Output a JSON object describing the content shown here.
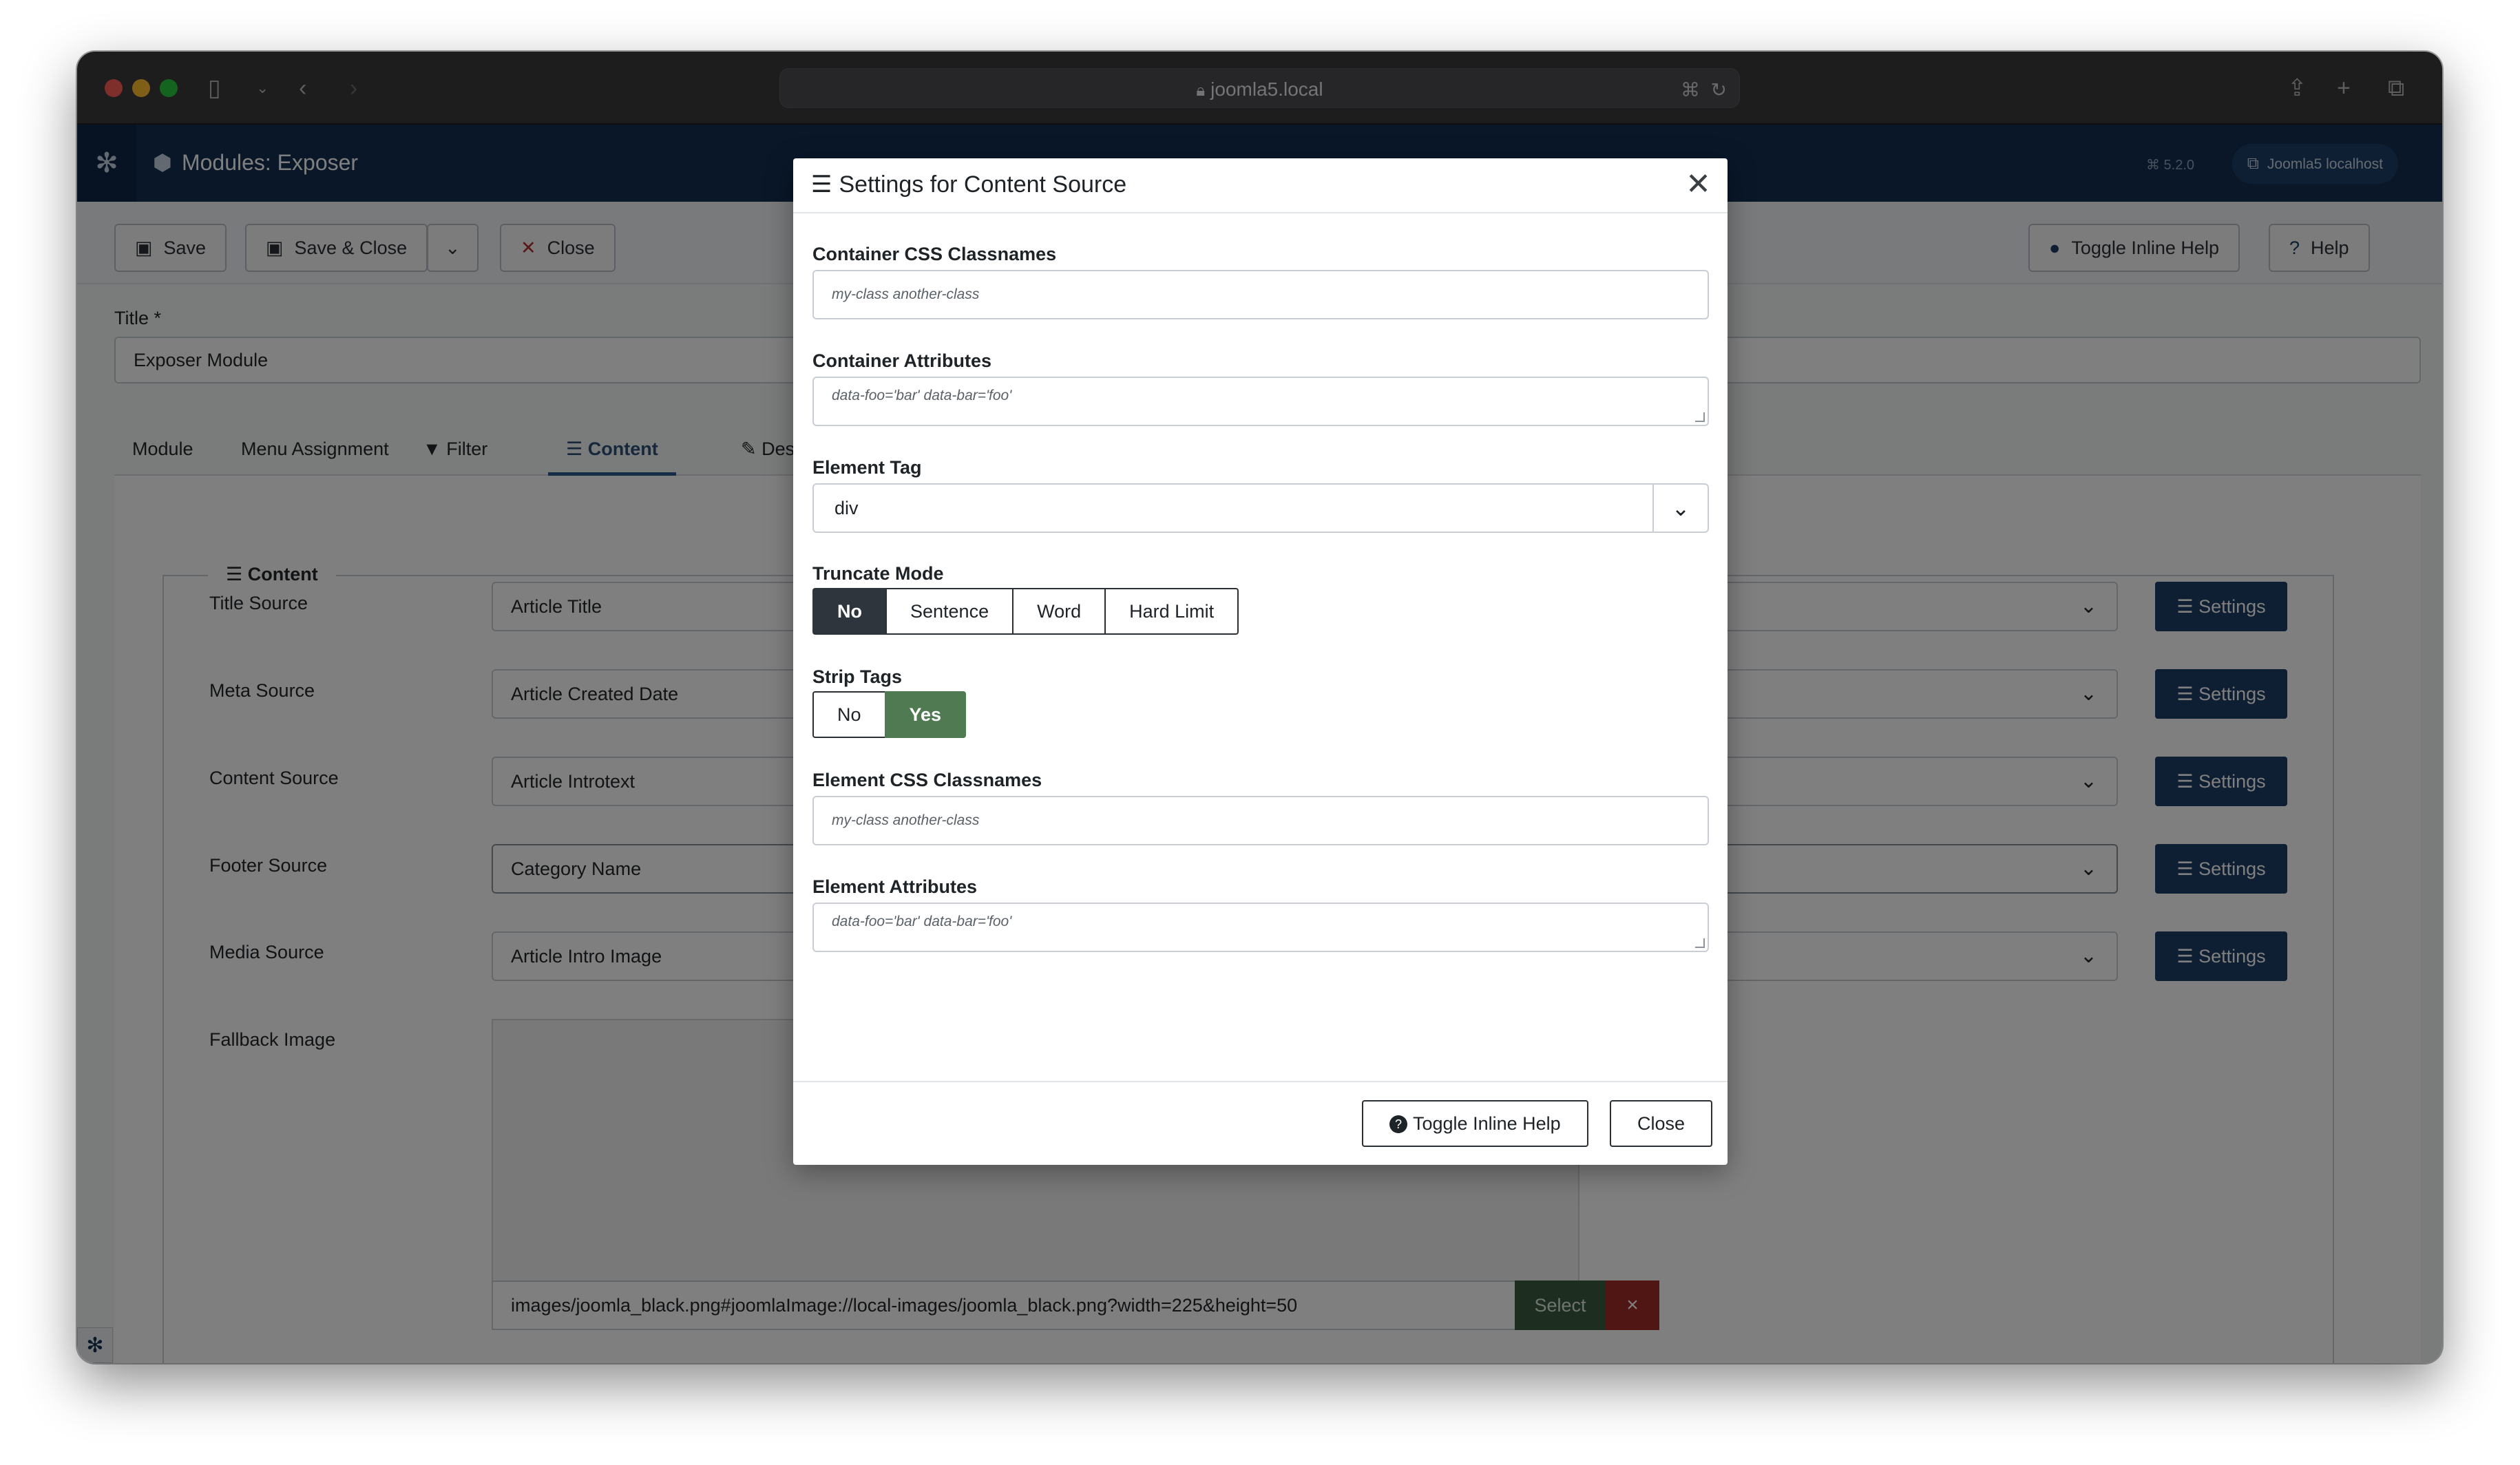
{
  "browser": {
    "url": "joomla5.local"
  },
  "header": {
    "title": "Modules: Exposer",
    "version": "5.2.0",
    "site_link": "Joomla5 localhost"
  },
  "toolbar": {
    "save": "Save",
    "save_close": "Save & Close",
    "close": "Close",
    "toggle_inline_help": "Toggle Inline Help",
    "help": "Help"
  },
  "form": {
    "title_label": "Title *",
    "title_value": "Exposer Module"
  },
  "tabs": [
    {
      "label": "Module"
    },
    {
      "label": "Menu Assignment"
    },
    {
      "label": "Filter"
    },
    {
      "label": "Content"
    },
    {
      "label": "Designer"
    }
  ],
  "content": {
    "legend": "Content",
    "rows": [
      {
        "label": "Title Source",
        "value": "Article Title",
        "button": "Settings"
      },
      {
        "label": "Meta Source",
        "value": "Article Created Date",
        "button": "Settings"
      },
      {
        "label": "Content Source",
        "value": "Article Introtext",
        "button": "Settings"
      },
      {
        "label": "Footer Source",
        "value": "Category Name",
        "button": "Settings"
      },
      {
        "label": "Media Source",
        "value": "Article Intro Image",
        "button": "Settings"
      }
    ],
    "fallback_label": "Fallback Image",
    "fallback_value": "images/joomla_black.png#joomlaImage://local-images/joomla_black.png?width=225&height=50",
    "select_label": "Select",
    "clear_label": "×"
  },
  "modal": {
    "title": "Settings for Content Source",
    "container_css_label": "Container CSS Classnames",
    "container_css_placeholder": "my-class another-class",
    "container_attr_label": "Container Attributes",
    "container_attr_placeholder": "data-foo='bar' data-bar='foo'",
    "element_tag_label": "Element Tag",
    "element_tag_value": "div",
    "truncate_label": "Truncate Mode",
    "truncate_options": [
      "No",
      "Sentence",
      "Word",
      "Hard Limit"
    ],
    "strip_tags_label": "Strip Tags",
    "strip_tags_options": [
      "No",
      "Yes"
    ],
    "element_css_label": "Element CSS Classnames",
    "element_css_placeholder": "my-class another-class",
    "element_attr_label": "Element Attributes",
    "element_attr_placeholder": "data-foo='bar' data-bar='foo'",
    "toggle_help": "Toggle Inline Help",
    "close": "Close"
  },
  "colors": {
    "header_bg": "#132f53",
    "settings_btn": "#1f3f66",
    "select_btn": "#3a5a40",
    "clear_btn": "#a02c27",
    "active_yes": "#4f7a52",
    "active_no": "#2e353c"
  }
}
